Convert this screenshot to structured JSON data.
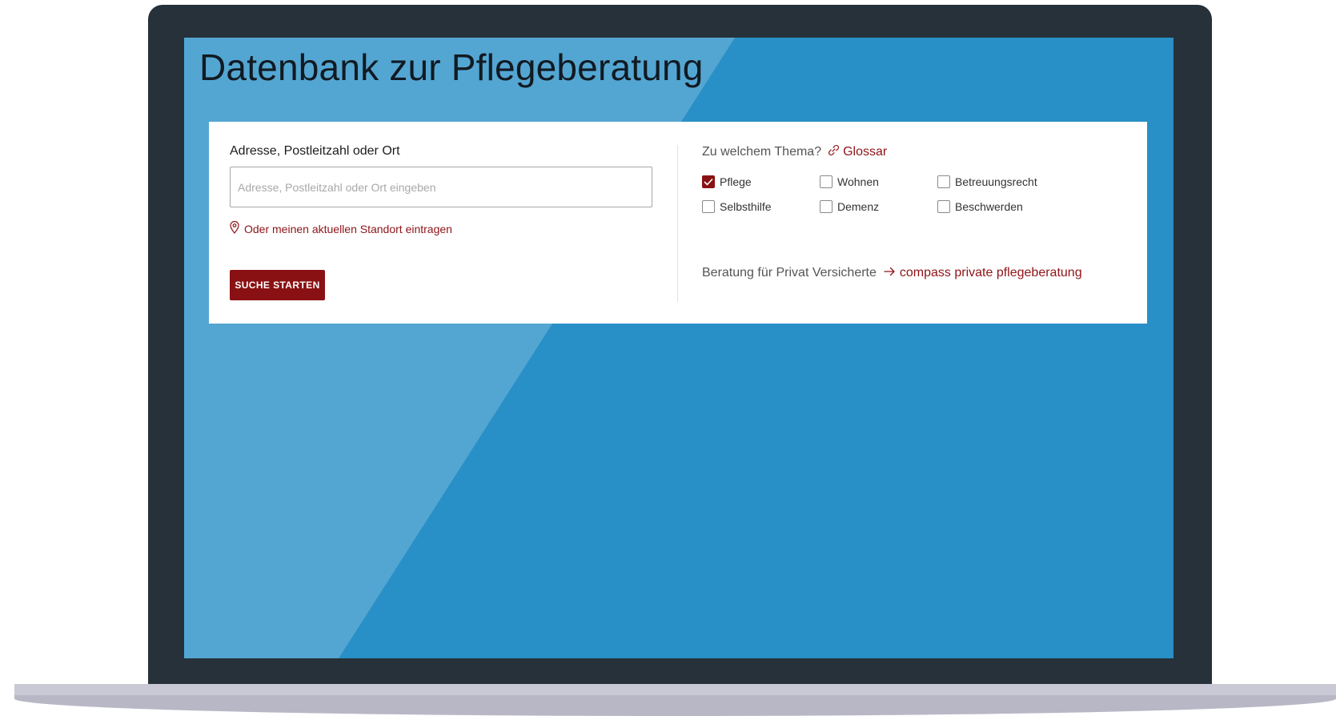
{
  "page": {
    "title": "Datenbank zur Pflegeberatung"
  },
  "search": {
    "label": "Adresse, Postleitzahl oder Ort",
    "value": "",
    "placeholder": "Adresse, Postleitzahl oder Ort eingeben",
    "location_link": "Oder meinen aktuellen Standort eintragen",
    "button_label": "SUCHE STARTEN"
  },
  "topics": {
    "question": "Zu welchem Thema?",
    "glossary_link": "Glossar",
    "items": [
      {
        "label": "Pflege",
        "checked": true
      },
      {
        "label": "Wohnen",
        "checked": false
      },
      {
        "label": "Betreuungsrecht",
        "checked": false
      },
      {
        "label": "Selbsthilfe",
        "checked": false
      },
      {
        "label": "Demenz",
        "checked": false
      },
      {
        "label": "Beschwerden",
        "checked": false
      }
    ]
  },
  "private": {
    "text": "Beratung für Privat Versicherte",
    "link": "compass private pflegeberatung"
  },
  "icons": {
    "location": "map-pin-icon",
    "glossary": "link-icon",
    "private_link": "arrow-right-icon",
    "checkbox_check": "check-icon"
  },
  "colors": {
    "accent": "#8a1113",
    "link": "#8e1418",
    "screen_blue": "#2990c7",
    "screen_light_blue": "#54a6d2",
    "bezel": "#263139"
  }
}
